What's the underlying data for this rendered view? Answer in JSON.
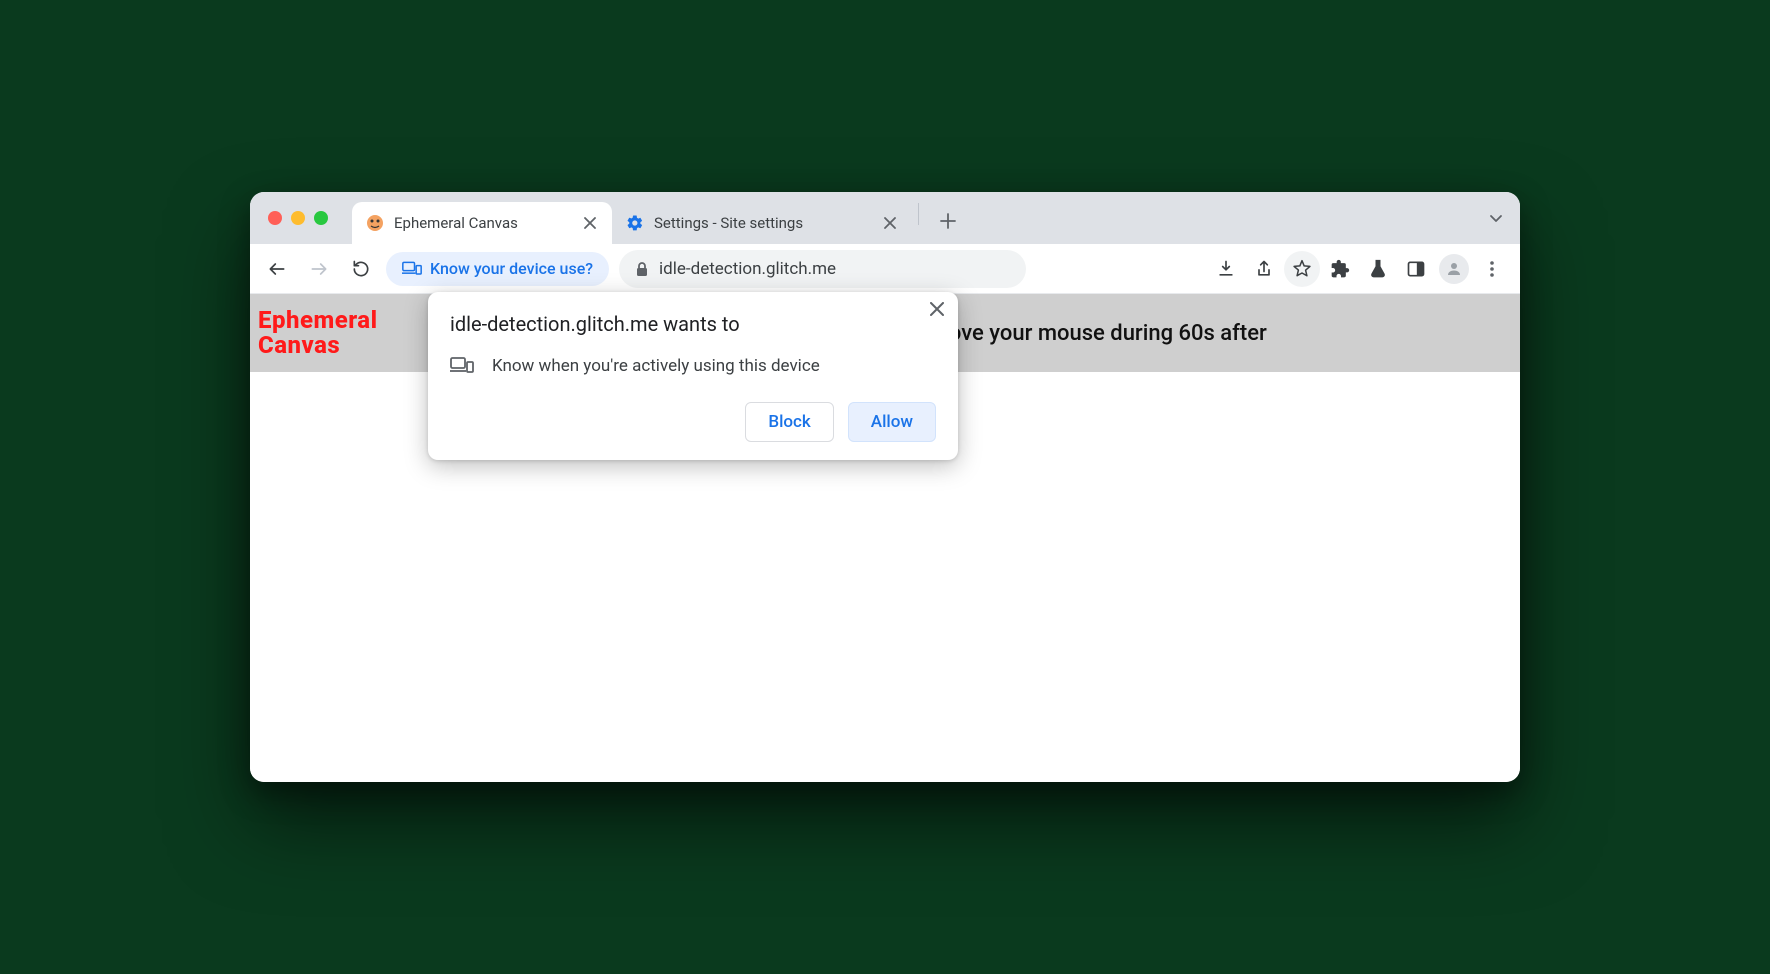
{
  "tabs": [
    {
      "title": "Ephemeral Canvas",
      "active": true,
      "favicon": "fish"
    },
    {
      "title": "Settings - Site settings",
      "active": false,
      "favicon": "gear-blue"
    }
  ],
  "toolbar": {
    "permission_chip": "Know your device use?",
    "url": "idle-detection.glitch.me"
  },
  "page": {
    "logo_line1": "Ephemeral",
    "logo_line2": "Canvas",
    "banner_msg": "(Don't move your mouse during 60s after"
  },
  "permission_popup": {
    "title": "idle-detection.glitch.me wants to",
    "item": "Know when you're actively using this device",
    "block": "Block",
    "allow": "Allow"
  }
}
